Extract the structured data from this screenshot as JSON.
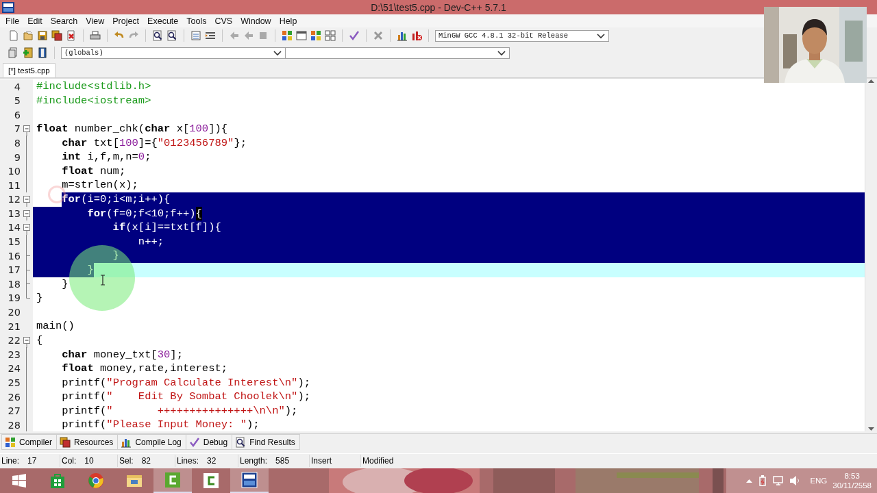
{
  "window": {
    "title": "D:\\51\\test5.cpp - Dev-C++ 5.7.1"
  },
  "menu": [
    "File",
    "Edit",
    "Search",
    "View",
    "Project",
    "Execute",
    "Tools",
    "CVS",
    "Window",
    "Help"
  ],
  "toolbar": {
    "compiler": "MinGW GCC 4.8.1 32-bit Release",
    "scope": "(globals)"
  },
  "tabs": [
    {
      "label": "[*] test5.cpp",
      "selected": true
    }
  ],
  "editor": {
    "lines": [
      {
        "number": "4",
        "fold": {
          "kind": "none"
        },
        "selection": {
          "kind": "none"
        },
        "tokens": [
          {
            "kind": "pre",
            "t": "#include<stdlib.h>"
          }
        ]
      },
      {
        "number": "5",
        "fold": {
          "kind": "none"
        },
        "selection": {
          "kind": "none"
        },
        "tokens": [
          {
            "kind": "pre",
            "t": "#include<iostream>"
          }
        ]
      },
      {
        "number": "6",
        "fold": {
          "kind": "none"
        },
        "selection": {
          "kind": "none"
        }
      },
      {
        "number": "7",
        "fold": {
          "kind": "box"
        },
        "selection": {
          "kind": "none"
        },
        "tokens": [
          {
            "kind": "kw",
            "t": "float"
          },
          {
            "kind": "p",
            "t": " number_chk("
          },
          {
            "kind": "kw",
            "t": "char"
          },
          {
            "kind": "p",
            "t": " x["
          },
          {
            "kind": "num",
            "t": "100"
          },
          {
            "kind": "p",
            "t": "]){"
          }
        ]
      },
      {
        "number": "8",
        "fold": {
          "kind": "line"
        },
        "selection": {
          "kind": "none"
        },
        "tokens": [
          {
            "kind": "kw",
            "t": "    char"
          },
          {
            "kind": "p",
            "t": " txt["
          },
          {
            "kind": "num",
            "t": "100"
          },
          {
            "kind": "p",
            "t": "]={"
          },
          {
            "kind": "str",
            "t": "\"0123456789\""
          },
          {
            "kind": "p",
            "t": "};"
          }
        ]
      },
      {
        "number": "9",
        "fold": {
          "kind": "line"
        },
        "selection": {
          "kind": "none"
        },
        "tokens": [
          {
            "kind": "kw",
            "t": "    int"
          },
          {
            "kind": "p",
            "t": " i,f,m,n="
          },
          {
            "kind": "num",
            "t": "0"
          },
          {
            "kind": "p",
            "t": ";"
          }
        ]
      },
      {
        "number": "10",
        "fold": {
          "kind": "line"
        },
        "selection": {
          "kind": "none"
        },
        "tokens": [
          {
            "kind": "kw",
            "t": "    float"
          },
          {
            "kind": "p",
            "t": " num;"
          }
        ]
      },
      {
        "number": "11",
        "fold": {
          "kind": "line"
        },
        "selection": {
          "kind": "none"
        },
        "tokens": [
          {
            "kind": "p",
            "t": "    m=strlen(x);"
          }
        ]
      },
      {
        "number": "12",
        "fold": {
          "kind": "box"
        },
        "selection": {
          "kind": "from_code"
        },
        "tokens": [
          {
            "kind": "kw",
            "t": "    for"
          },
          {
            "kind": "p",
            "t": "(i="
          },
          {
            "kind": "num",
            "t": "0"
          },
          {
            "kind": "p",
            "t": ";i<m;i++){"
          }
        ]
      },
      {
        "number": "13",
        "fold": {
          "kind": "box"
        },
        "selection": {
          "kind": "all"
        },
        "tokens": [
          {
            "kind": "kw",
            "t": "        for"
          },
          {
            "kind": "p",
            "t": "(f="
          },
          {
            "kind": "num",
            "t": "0"
          },
          {
            "kind": "p",
            "t": ";f<"
          },
          {
            "kind": "num",
            "t": "10"
          },
          {
            "kind": "p",
            "t": ";f++)"
          },
          {
            "kind": "match",
            "t": "{"
          }
        ]
      },
      {
        "number": "14",
        "fold": {
          "kind": "box"
        },
        "selection": {
          "kind": "all"
        },
        "tokens": [
          {
            "kind": "kw",
            "t": "            if"
          },
          {
            "kind": "p",
            "t": "(x[i]==txt[f]){"
          }
        ]
      },
      {
        "number": "15",
        "fold": {
          "kind": "line"
        },
        "selection": {
          "kind": "all"
        },
        "tokens": [
          {
            "kind": "p",
            "t": "                n++;"
          }
        ]
      },
      {
        "number": "16",
        "fold": {
          "kind": "tick"
        },
        "selection": {
          "kind": "all"
        },
        "tokens": [
          {
            "kind": "p",
            "t": "            }"
          }
        ]
      },
      {
        "number": "17",
        "fold": {
          "kind": "tick"
        },
        "selection": {
          "kind": "to_caret"
        },
        "tokens": [
          {
            "kind": "p",
            "t": "        }"
          }
        ]
      },
      {
        "number": "18",
        "fold": {
          "kind": "tick"
        },
        "selection": {
          "kind": "none"
        },
        "tokens": [
          {
            "kind": "p",
            "t": "    }"
          }
        ]
      },
      {
        "number": "19",
        "fold": {
          "kind": "end"
        },
        "selection": {
          "kind": "none"
        },
        "tokens": [
          {
            "kind": "p",
            "t": "}"
          }
        ]
      },
      {
        "number": "20",
        "fold": {
          "kind": "none"
        },
        "selection": {
          "kind": "none"
        }
      },
      {
        "number": "21",
        "fold": {
          "kind": "none"
        },
        "selection": {
          "kind": "none"
        },
        "tokens": [
          {
            "kind": "p",
            "t": "main()"
          }
        ]
      },
      {
        "number": "22",
        "fold": {
          "kind": "box"
        },
        "selection": {
          "kind": "none"
        },
        "tokens": [
          {
            "kind": "p",
            "t": "{"
          }
        ]
      },
      {
        "number": "23",
        "fold": {
          "kind": "line"
        },
        "selection": {
          "kind": "none"
        },
        "tokens": [
          {
            "kind": "kw",
            "t": "    char"
          },
          {
            "kind": "p",
            "t": " money_txt["
          },
          {
            "kind": "num",
            "t": "30"
          },
          {
            "kind": "p",
            "t": "];"
          }
        ]
      },
      {
        "number": "24",
        "fold": {
          "kind": "line"
        },
        "selection": {
          "kind": "none"
        },
        "tokens": [
          {
            "kind": "kw",
            "t": "    float"
          },
          {
            "kind": "p",
            "t": " money,rate,interest;"
          }
        ]
      },
      {
        "number": "25",
        "fold": {
          "kind": "line"
        },
        "selection": {
          "kind": "none"
        },
        "tokens": [
          {
            "kind": "p",
            "t": "    printf("
          },
          {
            "kind": "str",
            "t": "\"Program Calculate Interest\\n\""
          },
          {
            "kind": "p",
            "t": ");"
          }
        ]
      },
      {
        "number": "26",
        "fold": {
          "kind": "line"
        },
        "selection": {
          "kind": "none"
        },
        "tokens": [
          {
            "kind": "p",
            "t": "    printf("
          },
          {
            "kind": "str",
            "t": "\"    Edit By Sombat Choolek\\n\""
          },
          {
            "kind": "p",
            "t": ");"
          }
        ]
      },
      {
        "number": "27",
        "fold": {
          "kind": "line"
        },
        "selection": {
          "kind": "none"
        },
        "tokens": [
          {
            "kind": "p",
            "t": "    printf("
          },
          {
            "kind": "str",
            "t": "\"       +++++++++++++++\\n\\n\""
          },
          {
            "kind": "p",
            "t": ");"
          }
        ]
      },
      {
        "number": "28",
        "fold": {
          "kind": "line"
        },
        "selection": {
          "kind": "none"
        },
        "tokens": [
          {
            "kind": "p",
            "t": "    printf("
          },
          {
            "kind": "str",
            "t": "\"Please Input Money: \""
          },
          {
            "kind": "p",
            "t": ");"
          }
        ]
      }
    ]
  },
  "bottom_tabs": [
    "Compiler",
    "Resources",
    "Compile Log",
    "Debug",
    "Find Results"
  ],
  "status_bar": {
    "fields": [
      {
        "label": "Line:",
        "value": "17"
      },
      {
        "label": "Col:",
        "value": "10"
      },
      {
        "label": "Sel:",
        "value": "82"
      },
      {
        "label": "Lines:",
        "value": "32"
      },
      {
        "label": "Length:",
        "value": "585"
      }
    ],
    "mode": "Insert",
    "state": "Modified"
  },
  "taskbar": {
    "language": "ENG",
    "time": "8:53",
    "date": "30/11/2558"
  }
}
